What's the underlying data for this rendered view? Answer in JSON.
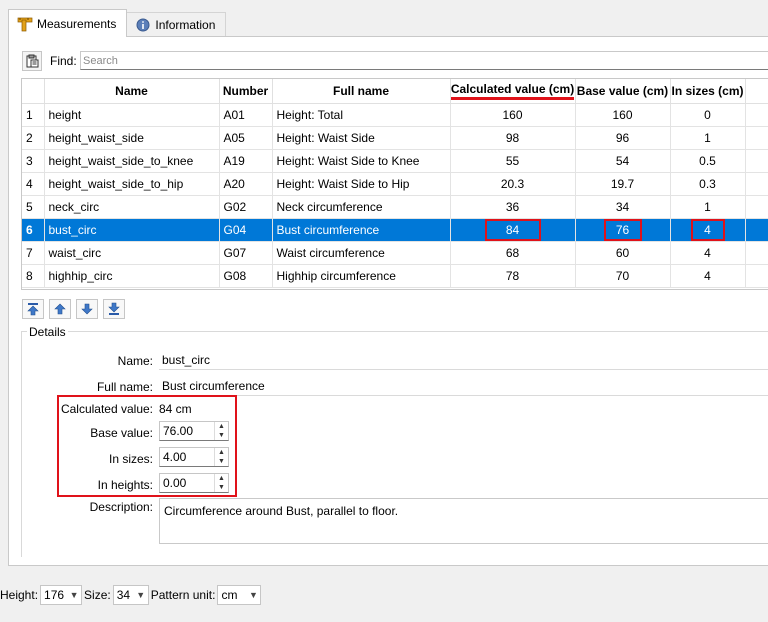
{
  "tabs": [
    {
      "label": "Measurements",
      "icon": "ruler-icon",
      "active": true
    },
    {
      "label": "Information",
      "icon": "info-icon",
      "active": false
    }
  ],
  "find": {
    "label": "Find:",
    "placeholder": "Search"
  },
  "table": {
    "headers": [
      "",
      "Name",
      "Number",
      "Full name",
      "Calculated value (cm)",
      "Base value (cm)",
      "In sizes (cm)"
    ],
    "rows": [
      {
        "n": "1",
        "name": "height",
        "number": "A01",
        "full": "Height: Total",
        "calc": "160",
        "base": "160",
        "sizes": "0"
      },
      {
        "n": "2",
        "name": "height_waist_side",
        "number": "A05",
        "full": "Height: Waist Side",
        "calc": "98",
        "base": "96",
        "sizes": "1"
      },
      {
        "n": "3",
        "name": "height_waist_side_to_knee",
        "number": "A19",
        "full": "Height: Waist Side to Knee",
        "calc": "55",
        "base": "54",
        "sizes": "0.5"
      },
      {
        "n": "4",
        "name": "height_waist_side_to_hip",
        "number": "A20",
        "full": "Height: Waist Side to Hip",
        "calc": "20.3",
        "base": "19.7",
        "sizes": "0.3"
      },
      {
        "n": "5",
        "name": "neck_circ",
        "number": "G02",
        "full": "Neck circumference",
        "calc": "36",
        "base": "34",
        "sizes": "1"
      },
      {
        "n": "6",
        "name": "bust_circ",
        "number": "G04",
        "full": "Bust circumference",
        "calc": "84",
        "base": "76",
        "sizes": "4"
      },
      {
        "n": "7",
        "name": "waist_circ",
        "number": "G07",
        "full": "Waist circumference",
        "calc": "68",
        "base": "60",
        "sizes": "4"
      },
      {
        "n": "8",
        "name": "highhip_circ",
        "number": "G08",
        "full": "Highhip circumference",
        "calc": "78",
        "base": "70",
        "sizes": "4"
      }
    ],
    "selected_row": "6"
  },
  "nav_buttons": [
    "move-top-icon",
    "move-up-icon",
    "move-down-icon",
    "move-bottom-icon"
  ],
  "details": {
    "title": "Details",
    "name_label": "Name:",
    "name_value": "bust_circ",
    "fullname_label": "Full name:",
    "fullname_value": "Bust circumference",
    "calc_label": "Calculated value:",
    "calc_value": "84 cm",
    "base_label": "Base value:",
    "base_value": "76.00",
    "sizes_label": "In sizes:",
    "sizes_value": "4.00",
    "heights_label": "In heights:",
    "heights_value": "0.00",
    "desc_label": "Description:",
    "desc_value": "Circumference around Bust, parallel to floor."
  },
  "bottom": {
    "height_label": "Height:",
    "height_value": "176",
    "size_label": "Size:",
    "size_value": "34",
    "unit_label": "Pattern unit:",
    "unit_value": "cm"
  },
  "colors": {
    "selection": "#0078d7",
    "annotation": "#e0121a"
  }
}
